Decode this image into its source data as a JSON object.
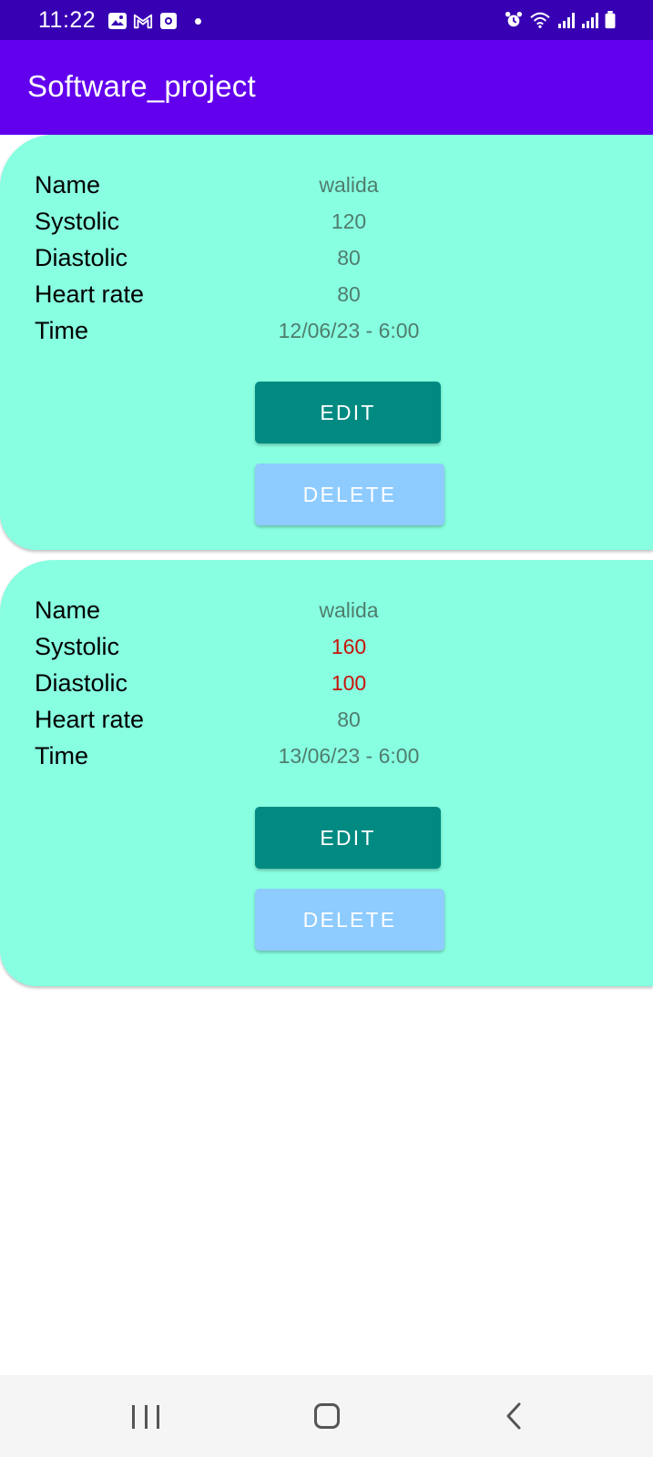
{
  "status_bar": {
    "time": "11:22",
    "icons_left": [
      "image-icon",
      "gmail-icon",
      "app-icon",
      "dot"
    ],
    "icons_right": [
      "alarm-icon",
      "wifi-icon",
      "signal-icon",
      "signal-icon",
      "battery-icon"
    ]
  },
  "app_bar": {
    "title": "Software_project",
    "color": "#6200ee"
  },
  "records": [
    {
      "rows": [
        {
          "label": "Name",
          "value": "walida"
        },
        {
          "label": "Systolic",
          "value": "120"
        },
        {
          "label": "Diastolic",
          "value": "80"
        },
        {
          "label": "Heart rate",
          "value": "80"
        },
        {
          "label": "Time",
          "value": "12/06/23 - 6:00"
        }
      ],
      "edit_label": "EDIT",
      "delete_label": "DELETE"
    },
    {
      "rows": [
        {
          "label": "Name",
          "value": "walida"
        },
        {
          "label": "Systolic",
          "value": "160"
        },
        {
          "label": "Diastolic",
          "value": "100"
        },
        {
          "label": "Heart rate",
          "value": "80"
        },
        {
          "label": "Time",
          "value": "13/06/23 - 6:00"
        }
      ],
      "edit_label": "EDIT",
      "delete_label": "DELETE"
    }
  ],
  "colors": {
    "card_background": "#88ffe1",
    "edit_button": "#008a82",
    "delete_button": "#8ecbff",
    "alert_value": "#c8140a"
  },
  "nav_bar": {
    "icons": [
      "recents-icon",
      "home-icon",
      "back-icon"
    ]
  }
}
